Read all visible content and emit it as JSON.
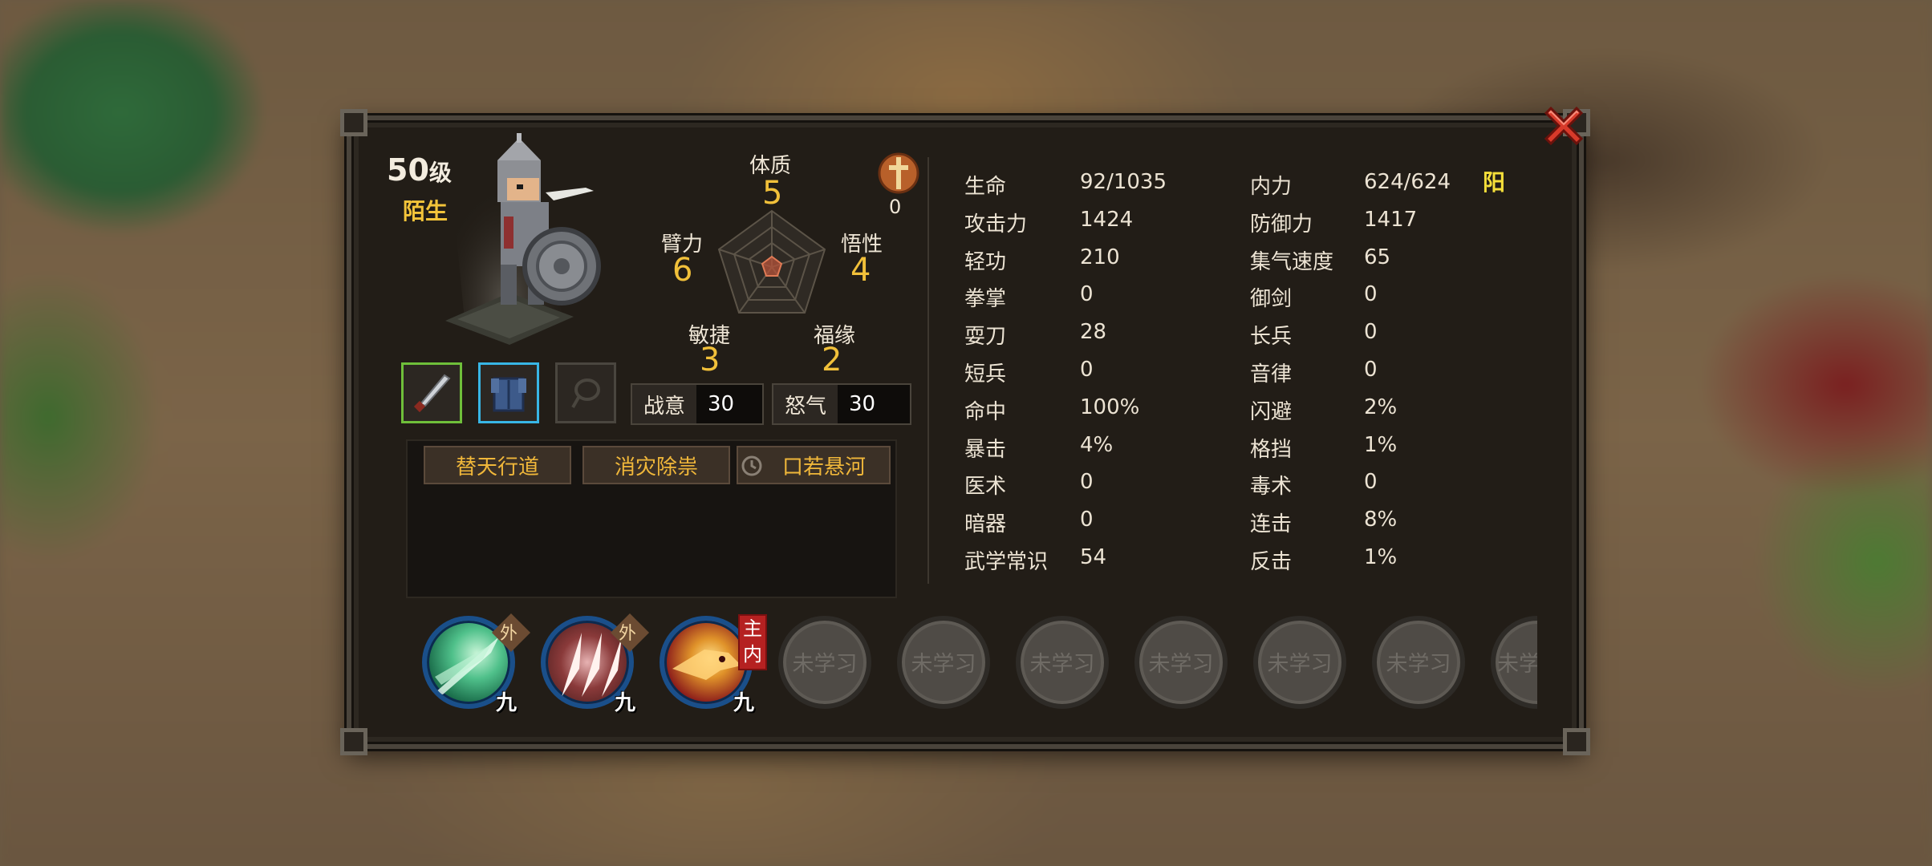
{
  "character": {
    "level_number": "50",
    "level_suffix": "级",
    "relationship": "陌生"
  },
  "radar": {
    "constitution": {
      "label": "体质",
      "value": "5"
    },
    "strength": {
      "label": "臂力",
      "value": "6"
    },
    "comprehension": {
      "label": "悟性",
      "value": "4"
    },
    "agility": {
      "label": "敏捷",
      "value": "3"
    },
    "fortune": {
      "label": "福缘",
      "value": "2"
    }
  },
  "spirit_count": "0",
  "meters": {
    "battle_will": {
      "label": "战意",
      "value": "30"
    },
    "rage": {
      "label": "怒气",
      "value": "30"
    }
  },
  "equipment": {
    "weapon_icon": "saber-icon",
    "armor_icon": "armor-icon",
    "accessory_icon": "empty-accessory-icon"
  },
  "titles": [
    "替天行道",
    "消灾除祟",
    "口若悬河"
  ],
  "attributes_left": [
    {
      "label": "生命",
      "value": "92/1035"
    },
    {
      "label": "攻击力",
      "value": "1424"
    },
    {
      "label": "轻功",
      "value": "210"
    },
    {
      "label": "拳掌",
      "value": "0"
    },
    {
      "label": "耍刀",
      "value": "28"
    },
    {
      "label": "短兵",
      "value": "0"
    },
    {
      "label": "命中",
      "value": "100%"
    },
    {
      "label": "暴击",
      "value": "4%"
    },
    {
      "label": "医术",
      "value": "0"
    },
    {
      "label": "暗器",
      "value": "0"
    },
    {
      "label": "武学常识",
      "value": "54"
    }
  ],
  "attributes_right": [
    {
      "label": "内力",
      "value": "624/624"
    },
    {
      "label": "防御力",
      "value": "1417"
    },
    {
      "label": "集气速度",
      "value": "65"
    },
    {
      "label": "御剑",
      "value": "0"
    },
    {
      "label": "长兵",
      "value": "0"
    },
    {
      "label": "音律",
      "value": "0"
    },
    {
      "label": "闪避",
      "value": "2%"
    },
    {
      "label": "格挡",
      "value": "1%"
    },
    {
      "label": "毒术",
      "value": "0"
    },
    {
      "label": "连击",
      "value": "8%"
    },
    {
      "label": "反击",
      "value": "1%"
    }
  ],
  "alignment": "阳",
  "skills": [
    {
      "type": "外",
      "grade": "九",
      "icon": "green-blade-skill-icon"
    },
    {
      "type": "外",
      "grade": "九",
      "icon": "claw-skill-icon"
    },
    {
      "type": "主内",
      "grade": "九",
      "icon": "fire-dragon-skill-icon"
    }
  ],
  "unlearned_label": "未学习",
  "unlearned_partial_label": "未学",
  "colors": {
    "accent_gold": "#f1c03a",
    "weapon_border": "#6fbf3a",
    "armor_border": "#38b6e6",
    "panel_bg": "#221d17"
  }
}
